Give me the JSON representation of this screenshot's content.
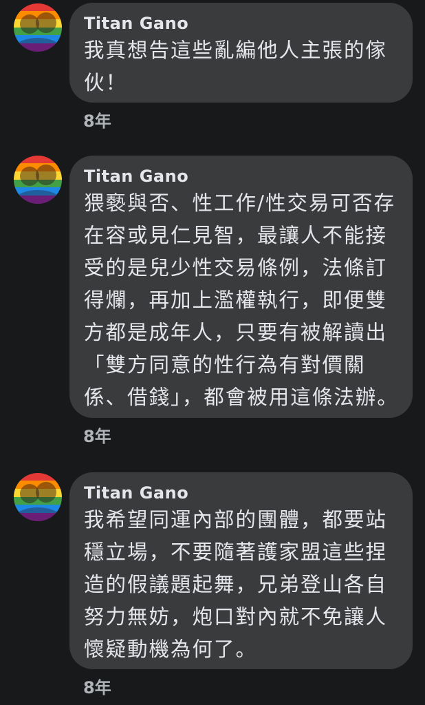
{
  "comments": [
    {
      "author": "Titan  Gano",
      "text": "我真想告這些亂編他人主張的傢伙！",
      "time": "8年"
    },
    {
      "author": "Titan  Gano",
      "text": "猥褻與否、性工作/性交易可否存在容或見仁見智，最讓人不能接受的是兒少性交易條例，法條訂得爛，再加上濫權執行，即便雙方都是成年人，只要有被解讀出「雙方同意的性行為有對價關係、借錢」，都會被用這條法辦。",
      "time": "8年"
    },
    {
      "author": "Titan  Gano",
      "text": "我希望同運內部的團體，都要站穩立場，不要隨著護家盟這些捏造的假議題起舞，兄弟登山各自努力無妨，炮口對內就不免讓人懷疑動機為何了。",
      "time": "8年"
    }
  ],
  "avatar": {
    "style": "rainbow-flag-portrait",
    "icon": "profile-avatar-icon"
  }
}
